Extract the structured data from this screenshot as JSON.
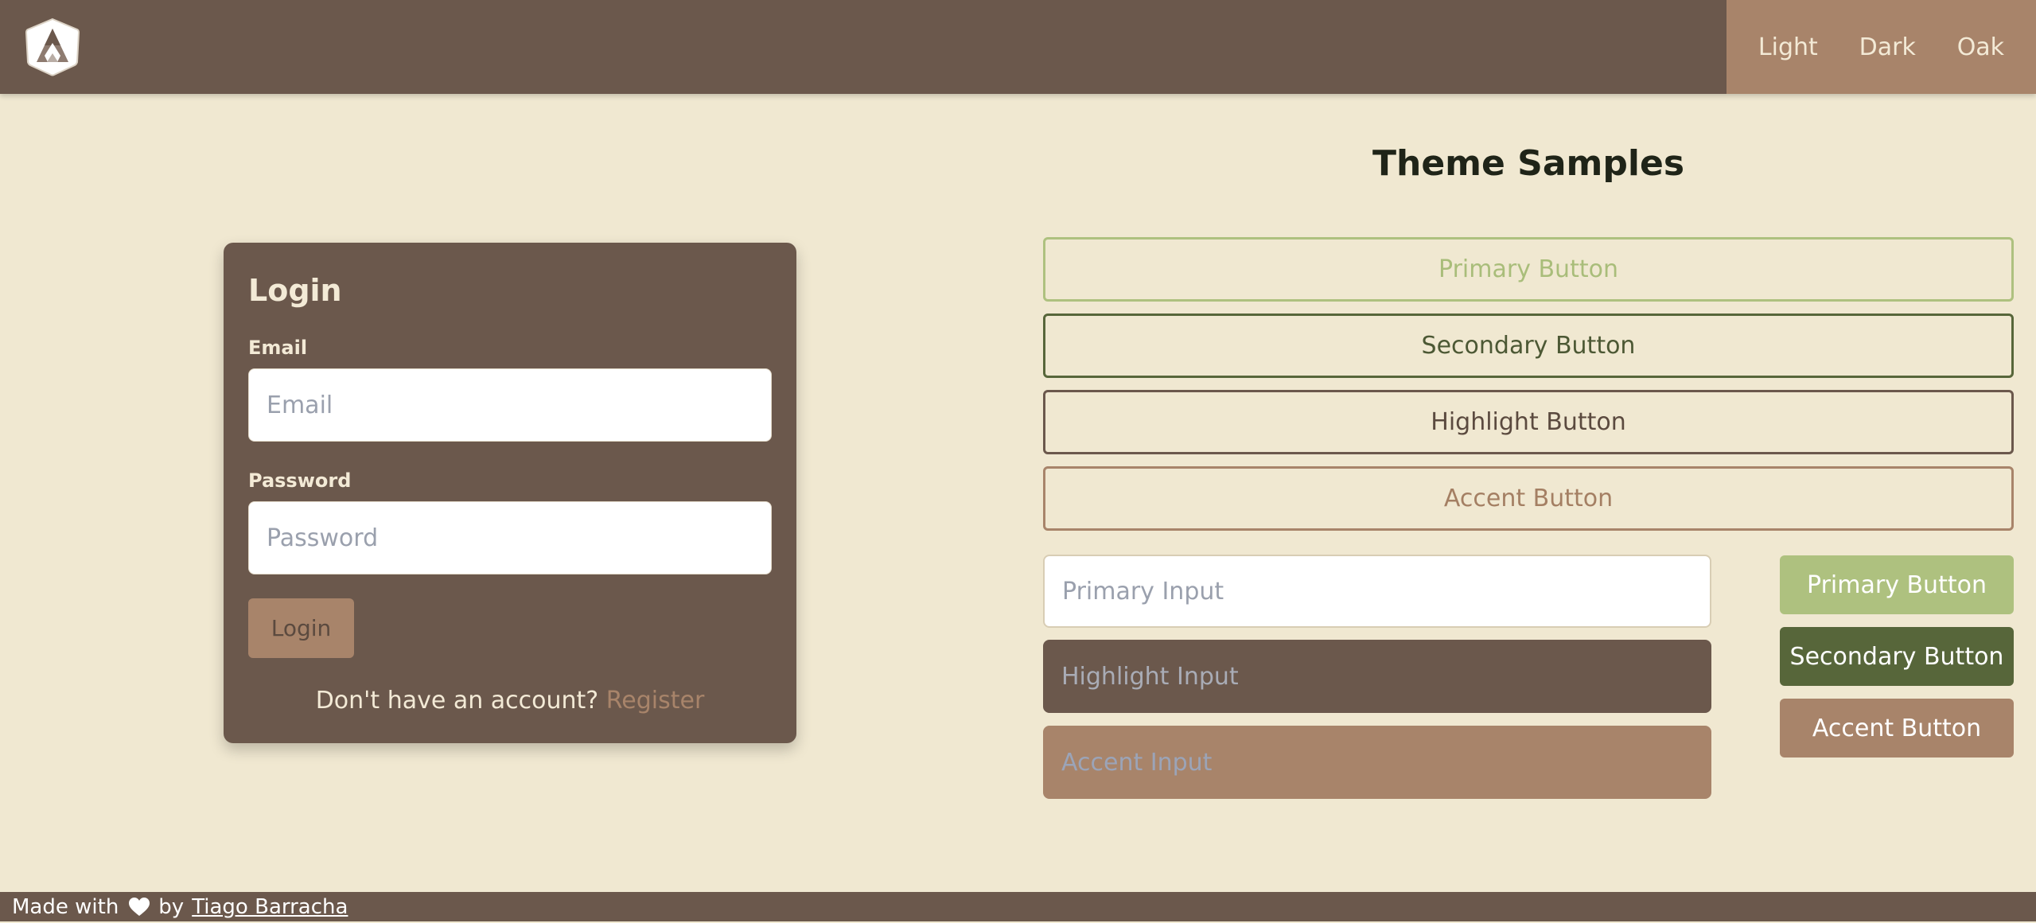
{
  "header": {
    "logo_icon": "app-logo-icon",
    "themes": [
      "Light",
      "Dark",
      "Oak"
    ]
  },
  "login": {
    "title": "Login",
    "email_label": "Email",
    "email_placeholder": "Email",
    "email_value": "",
    "password_label": "Password",
    "password_placeholder": "Password",
    "password_value": "",
    "submit_label": "Login",
    "register_prompt": "Don't have an account?",
    "register_link": "Register"
  },
  "samples": {
    "title": "Theme Samples",
    "outline_buttons": {
      "primary": "Primary Button",
      "secondary": "Secondary Button",
      "highlight": "Highlight Button",
      "accent": "Accent Button"
    },
    "inputs": {
      "primary_placeholder": "Primary Input",
      "highlight_placeholder": "Highlight Input",
      "accent_placeholder": "Accent Input"
    },
    "solid_buttons": {
      "primary": "Primary Button",
      "secondary": "Secondary Button",
      "accent": "Accent Button"
    }
  },
  "footer": {
    "made_with": "Made with",
    "heart_icon": "heart-icon",
    "by": "by",
    "author": "Tiago Barracha"
  },
  "colors": {
    "background": "#F0E8D1",
    "highlight": "#6B584C",
    "accent": "#A8846A",
    "primary": "#AEC17F",
    "secondary": "#57663A"
  }
}
